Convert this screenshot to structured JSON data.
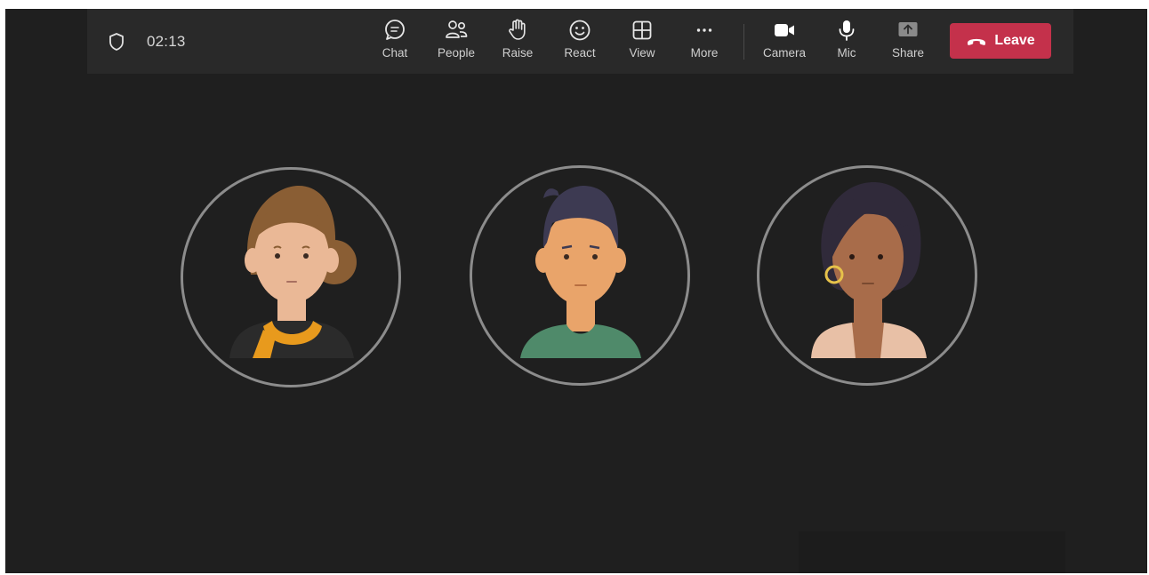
{
  "meeting": {
    "timer": "02:13"
  },
  "toolbar": {
    "buttons": [
      {
        "id": "chat",
        "label": "Chat",
        "icon": "chat-icon"
      },
      {
        "id": "people",
        "label": "People",
        "icon": "people-icon"
      },
      {
        "id": "raise",
        "label": "Raise",
        "icon": "raise-hand-icon"
      },
      {
        "id": "react",
        "label": "React",
        "icon": "smiley-icon"
      },
      {
        "id": "view",
        "label": "View",
        "icon": "grid-icon"
      },
      {
        "id": "more",
        "label": "More",
        "icon": "ellipsis-icon"
      },
      {
        "id": "camera",
        "label": "Camera",
        "icon": "camera-icon"
      },
      {
        "id": "mic",
        "label": "Mic",
        "icon": "mic-icon"
      },
      {
        "id": "share",
        "label": "Share",
        "icon": "share-screen-icon"
      }
    ],
    "leave_label": "Leave"
  },
  "colors": {
    "stage_bg": "#1f1f1f",
    "toolbar_bg": "#292929",
    "leave_red": "#c4314b",
    "avatar_ring": "#8c8c8c"
  },
  "participants": [
    {
      "avatar": "woman-brown-hair-avatar"
    },
    {
      "avatar": "man-dark-hair-avatar"
    },
    {
      "avatar": "woman-bob-hair-avatar"
    }
  ]
}
